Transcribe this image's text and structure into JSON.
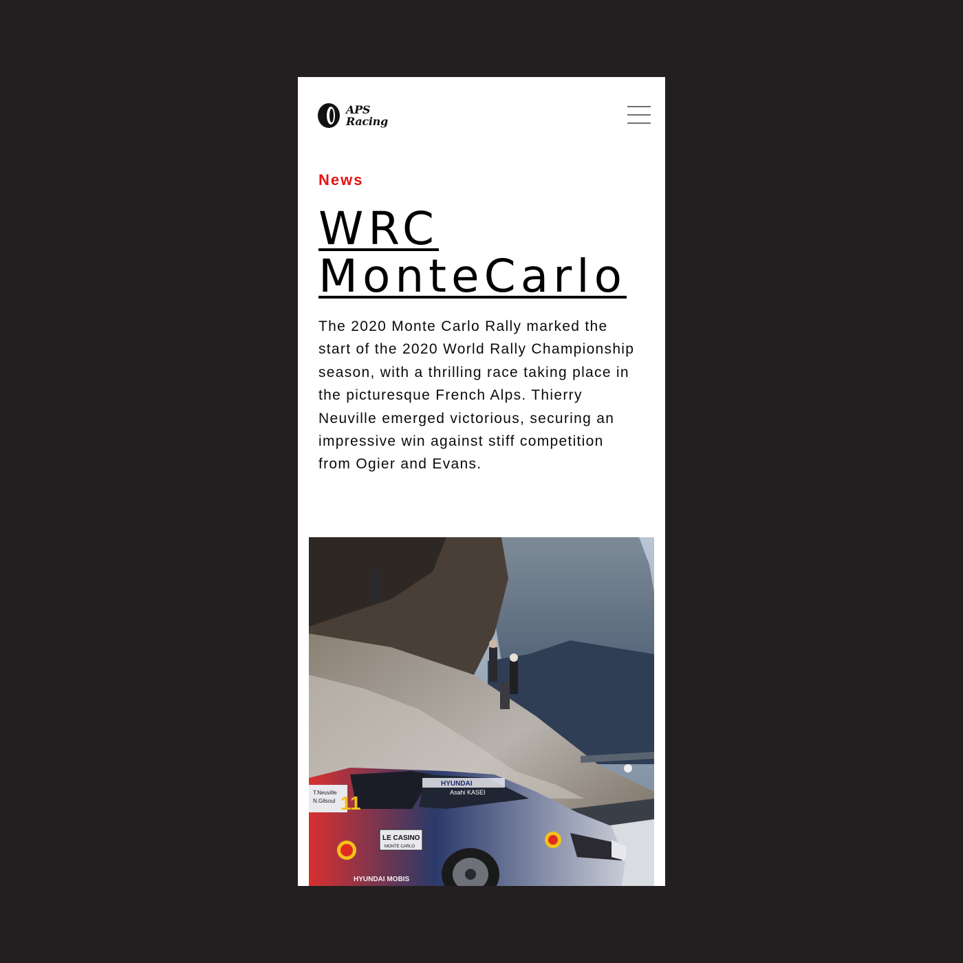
{
  "header": {
    "logo_line1": "APS",
    "logo_line2": "Racing",
    "logo_icon": "tire-icon",
    "menu_icon": "hamburger-menu-icon"
  },
  "article": {
    "category": "News",
    "title": "WRC\nMonteCarlo",
    "body": "The 2020 Monte Carlo Rally marked the start of the 2020 World Rally Championship season, with a thrilling race taking place in the picturesque French Alps. Thierry Neuville emerged victorious, securing an impressive win against stiff competition from Ogier and Evans."
  },
  "photo": {
    "car_decal_driver": "T.Neuville",
    "car_decal_codriver": "N.Gilsoul",
    "car_number": "11",
    "sponsor_banner": "LE CASINO",
    "sponsor_sub": "MONTE CARLO",
    "windshield_brand": "HYUNDAI",
    "windshield_sub": "Asahi KASEI",
    "door_text": "HYUNDAI MOBIS"
  },
  "colors": {
    "background": "#231f20",
    "card": "#ffffff",
    "accent": "#e41414",
    "text": "#000000"
  }
}
